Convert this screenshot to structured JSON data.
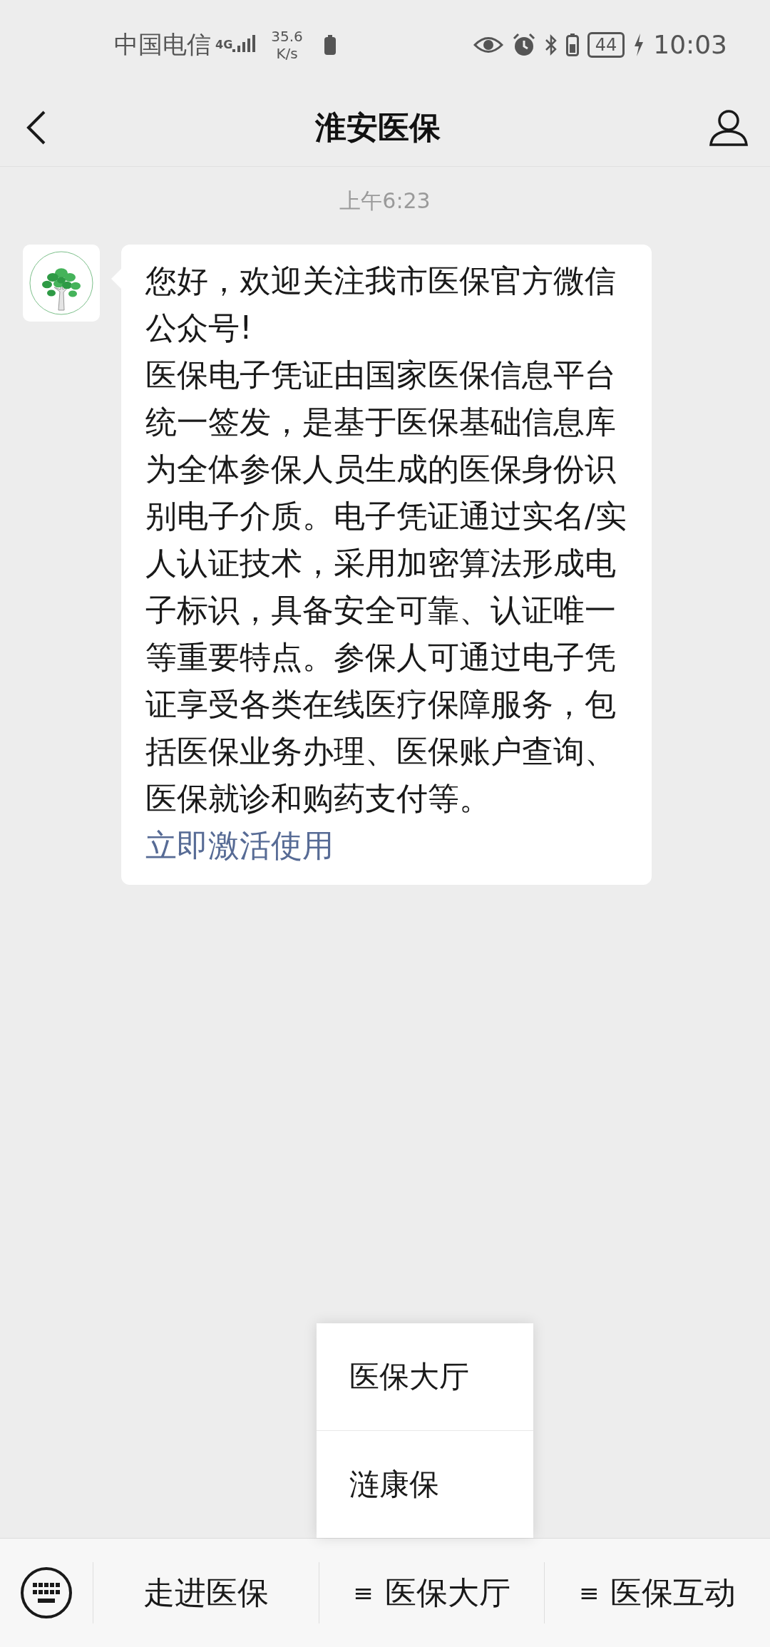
{
  "status_bar": {
    "carrier": "中国电信",
    "network": "4G",
    "speed_value": "35.6",
    "speed_unit": "K/s",
    "battery": "44",
    "time": "10:03"
  },
  "nav": {
    "title": "淮安医保"
  },
  "chat": {
    "timestamp": "上午6:23",
    "message": {
      "paragraphs": [
        "您好，欢迎关注我市医保官方微信公众号!",
        "医保电子凭证由国家医保信息平台统一签发，是基于医保基础信息库为全体参保人员生成的医保身份识别电子介质。电子凭证通过实名/实人认证技术，采用加密算法形成电子标识，具备安全可靠、认证唯一等重要特点。参保人可通过电子凭证享受各类在线医疗保障服务，包括医保业务办理、医保账户查询、医保就诊和购药支付等。"
      ],
      "link": "立即激活使用"
    }
  },
  "popup_menu": {
    "items": [
      "医保大厅",
      "涟康保"
    ]
  },
  "bottom_menu": {
    "items": [
      {
        "label": "走进医保"
      },
      {
        "label": "医保大厅",
        "marker": "≡"
      },
      {
        "label": "医保互动",
        "marker": "≡"
      }
    ]
  }
}
